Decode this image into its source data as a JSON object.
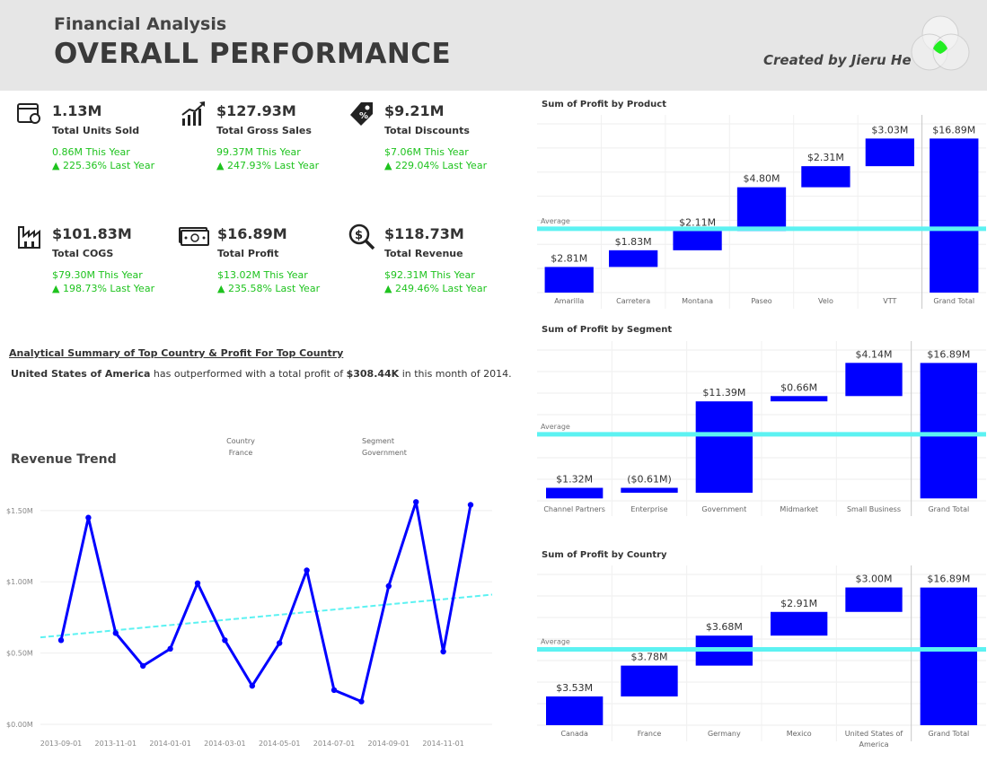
{
  "header": {
    "subtitle": "Financial Analysis",
    "title": "OVERALL PERFORMANCE",
    "credit": "Created by Jieru He"
  },
  "kpis": [
    {
      "icon": "box-icon",
      "value": "1.13M",
      "label": "Total Units Sold",
      "this_year": "0.86M This Year",
      "last_year": "▲ 225.36% Last Year"
    },
    {
      "icon": "growth-chart-icon",
      "value": "$127.93M",
      "label": "Total Gross Sales",
      "this_year": "99.37M This Year",
      "last_year": "▲ 247.93% Last Year"
    },
    {
      "icon": "price-tag-icon",
      "value": "$9.21M",
      "label": "Total Discounts",
      "this_year": "$7.06M This Year",
      "last_year": "▲ 229.04% Last Year"
    },
    {
      "icon": "factory-icon",
      "value": "$101.83M",
      "label": "Total COGS",
      "this_year": "$79.30M This Year",
      "last_year": "▲ 198.73% Last Year"
    },
    {
      "icon": "cash-icon",
      "value": "$16.89M",
      "label": "Total Profit",
      "this_year": "$13.02M This Year",
      "last_year": "▲ 235.58% Last Year"
    },
    {
      "icon": "dollar-search-icon",
      "value": "$118.73M",
      "label": "Total Revenue",
      "this_year": "$92.31M This Year",
      "last_year": "▲ 249.46% Last Year"
    }
  ],
  "summary": {
    "title": "Analytical Summary of Top Country & Profit For Top Country",
    "country": "United States of America",
    "text_1": " has outperformed with a total profit of  ",
    "profit": "$308.44K",
    "text_2": " in this month of 2014."
  },
  "filters": {
    "country_label": "Country",
    "country_value": "France",
    "segment_label": "Segment",
    "segment_value": "Government"
  },
  "revenue_trend_title": "Revenue Trend",
  "colors": {
    "bar": "#0000ff",
    "average_line": "#5cf2f2",
    "line": "#0000ff",
    "trend": "#5cf2f2",
    "kpi_green": "#1ec31e",
    "header_bg": "#e6e6e6"
  },
  "chart_data": [
    {
      "type": "bar",
      "waterfall": true,
      "title": "Sum of Profit by Product",
      "categories": [
        "Amarilla",
        "Carretera",
        "Montana",
        "Paseo",
        "Velo",
        "VTT",
        "Grand Total"
      ],
      "values": [
        2.81,
        1.83,
        2.11,
        4.8,
        2.31,
        3.03,
        16.89
      ],
      "labels": [
        "$2.81M",
        "$1.83M",
        "$2.11M",
        "$4.80M",
        "$2.31M",
        "$3.03M",
        "$16.89M"
      ],
      "reference_line_label": "Average",
      "reference_line_value": 7.0,
      "ylim": [
        0,
        18.5
      ],
      "unit": "$M",
      "grid": true
    },
    {
      "type": "bar",
      "waterfall": true,
      "title": "Sum of Profit by Segment",
      "categories": [
        "Channel Partners",
        "Enterprise",
        "Government",
        "Midmarket",
        "Small Business",
        "Grand Total"
      ],
      "values": [
        1.32,
        -0.61,
        11.39,
        0.66,
        4.14,
        16.89
      ],
      "labels": [
        "$1.32M",
        "($0.61M)",
        "$11.39M",
        "$0.66M",
        "$4.14M",
        "$16.89M"
      ],
      "reference_line_label": "Average",
      "reference_line_value": 8.0,
      "ylim": [
        -0.3,
        18.5
      ],
      "unit": "$M",
      "grid": true
    },
    {
      "type": "bar",
      "waterfall": true,
      "title": "Sum of Profit by Country",
      "categories": [
        "Canada",
        "France",
        "Germany",
        "Mexico",
        "United States of America",
        "Grand Total"
      ],
      "values": [
        3.53,
        3.78,
        3.68,
        2.91,
        3.0,
        16.89
      ],
      "labels": [
        "$3.53M",
        "$3.78M",
        "$3.68M",
        "$2.91M",
        "$3.00M",
        "$16.89M"
      ],
      "reference_line_label": "Average",
      "reference_line_value": 9.3,
      "ylim": [
        0,
        18.5
      ],
      "unit": "$M",
      "grid": true
    },
    {
      "type": "line",
      "title": "Revenue Trend",
      "x": [
        "2013-09-01",
        "2013-10-01",
        "2013-11-01",
        "2013-12-01",
        "2014-01-01",
        "2014-02-01",
        "2014-03-01",
        "2014-04-01",
        "2014-05-01",
        "2014-06-01",
        "2014-07-01",
        "2014-08-01",
        "2014-09-01",
        "2014-10-01",
        "2014-11-01",
        "2014-12-01"
      ],
      "values": [
        0.59,
        1.45,
        0.64,
        0.41,
        0.53,
        0.99,
        0.59,
        0.27,
        0.57,
        1.08,
        0.24,
        0.16,
        0.97,
        1.56,
        0.51,
        1.54
      ],
      "x_ticks": [
        "2013-09-01",
        "2013-11-01",
        "2014-01-01",
        "2014-03-01",
        "2014-05-01",
        "2014-07-01",
        "2014-09-01",
        "2014-11-01"
      ],
      "y_ticks": [
        "$0.00M",
        "$0.50M",
        "$1.00M",
        "$1.50M"
      ],
      "y_tick_values": [
        0,
        0.5,
        1.0,
        1.5
      ],
      "ylim": [
        0,
        1.65
      ],
      "trend_line": [
        0.61,
        0.91
      ],
      "unit": "$M",
      "grid": true
    }
  ]
}
